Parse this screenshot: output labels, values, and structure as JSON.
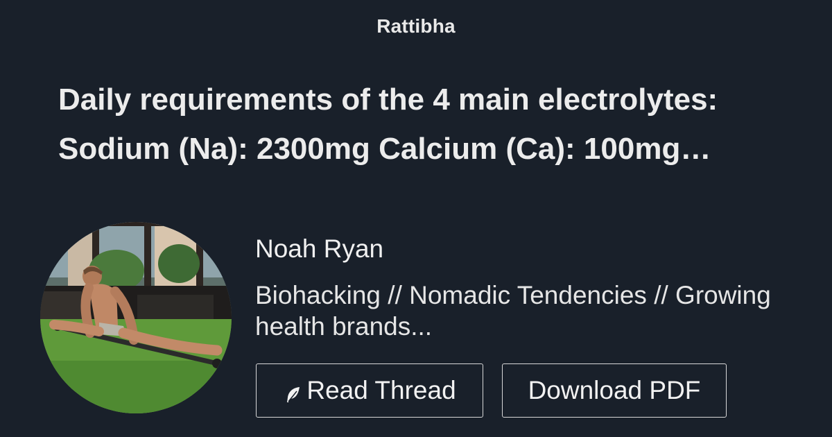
{
  "site": {
    "brand": "Rattibha"
  },
  "thread": {
    "title_line_1": "Daily requirements of the 4 main electrolytes:",
    "title_line_2": "Sodium (Na): 2300mg Calcium (Ca): 100mg…"
  },
  "author": {
    "name": "Noah Ryan",
    "bio_line_1": "Biohacking // Nomadic Tendencies // Growing",
    "bio_line_2": "health brands..."
  },
  "actions": {
    "read_label": "Read Thread",
    "read_icon": "feather-icon",
    "download_label": "Download PDF"
  },
  "colors": {
    "background": "#19202a",
    "text": "#ececec",
    "button_border": "#d9d9d9"
  }
}
